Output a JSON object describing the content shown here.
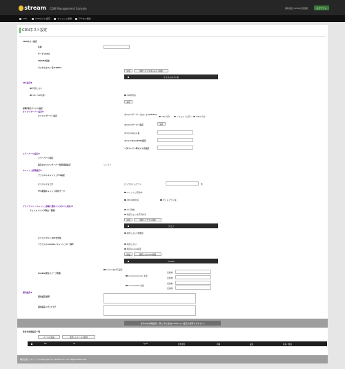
{
  "header": {
    "logo_text": "stream",
    "app_title": "CDN Management Console",
    "user_text": "契約会社:(1999) 担当者",
    "logout_label": "ログアウト",
    "nav": [
      "TOP",
      "CDNホスト設定",
      "キャッシュ削除",
      "アクセス統計"
    ]
  },
  "page": {
    "title": "CDNホスト設定",
    "cdn_host_section": "CDNホスト設定",
    "name_label": "名前",
    "service_url_label": "サービスURL",
    "cname_label": "CNAME追加",
    "custom_host_label": "カスタムホスト名(FQDN)",
    "add_btn": "追加",
    "remove_custom_btn": "選択したカスタムホスト削除",
    "custom_host_header": "カスタムホスト名",
    "ssl_section": "SSL設定▼",
    "ssl_none": "利用しない",
    "ssl_sni": "SSL (SNI利用)",
    "sni_unsupported": "SNI非対応",
    "ssl_settings_btn": "設定",
    "origin_section": "詳細/特定オリジン設定",
    "origin_server_section": "オリジンサーバー設定▼",
    "origin_server_label": "オリジンサーバー指定",
    "origin_protocol_label": "オリジンサーバープロトコル(HTTP)",
    "proto_http": "http のみ",
    "proto_request": "リクエストと同一",
    "proto_https": "https のみ",
    "origin_server_spec": "オリジンサーバー指定",
    "origin_set_btn": "設定",
    "origin_host_label": "オリジンホスト名",
    "origin_basepath_label": "オリジンBasePath指定",
    "redirect_host_label": "リダイレクト時ホスト名指定",
    "error_section": "エラーページ設定▼",
    "error_label": "エラーページ指定",
    "error_origin_label": "指定のオリジンサーバー時刻同期設定",
    "error_value": "リトライ",
    "cache_section": "キャッシュ詳細設定▼",
    "default_cache_label": "デフォルトキャッシュTTL指定",
    "origin_follow_label": "オリジンフォロウ",
    "lock_timeout_label": "ロックタイムアウト",
    "lock_unit": "秒",
    "ttl_mode_label": "TTL経過キャッシュ利用モード",
    "cache_enable": "キャッシュ有効中",
    "ims_label": "IMS/INM比較",
    "timeout_label": "タイムアウト時",
    "client_section": "クライアント / キャッシュ制御 (選択インスタンス対応)▼",
    "client_block_label": "クエリストリング除去／置換",
    "all_apply": "全て除去",
    "specific_apply": "指定クエリ文字列のみ",
    "add_query_btn": "追加",
    "remove_query_btn": "選択したクエリ削除",
    "query_header": "クエリ",
    "exclude_label": "除外しない(非推奨)",
    "origin_ip_label": "オリジンサイトのIPを送信",
    "cookie_section_label": "リクエストCookie, キャッシュキー操作",
    "cookie_none": "指定しない",
    "cookie_specific": "特定Cookie指定",
    "add_cookie_btn": "追加",
    "remove_cookie_btn": "選択したCookie削除",
    "cookie_header": "Cookie",
    "cookie_scope_label": "Cookie送信スコープ変換",
    "cookie_send": "Cookieを付与設定",
    "cookie_domain": "Cookie Domain 変換",
    "cookie_path": "Cookie Path 変換",
    "before_label": "変換前",
    "after_label": "変換後",
    "mgmt_section": "運用設定▼",
    "mgmt_note_label": "運用設定説明",
    "mgmt_memo_label": "運用設定メモ/フラグ",
    "save_btn": "表示中の詳細設定一覧に行を追加(CDNホスト設定を保存するボタン)",
    "list_section": "条件付詳細設定一覧",
    "add_rule_btn": "ルールを追加",
    "remove_rule_btn": "選択したルールを削除",
    "table_headers": [
      "No",
      "ID",
      "Type",
      "条件条件",
      "内容",
      "設定",
      "有効／無効"
    ],
    "footer_text": "株式会社ストリーム  Copyright (C) Stream Inc. All Rights Reserved."
  }
}
